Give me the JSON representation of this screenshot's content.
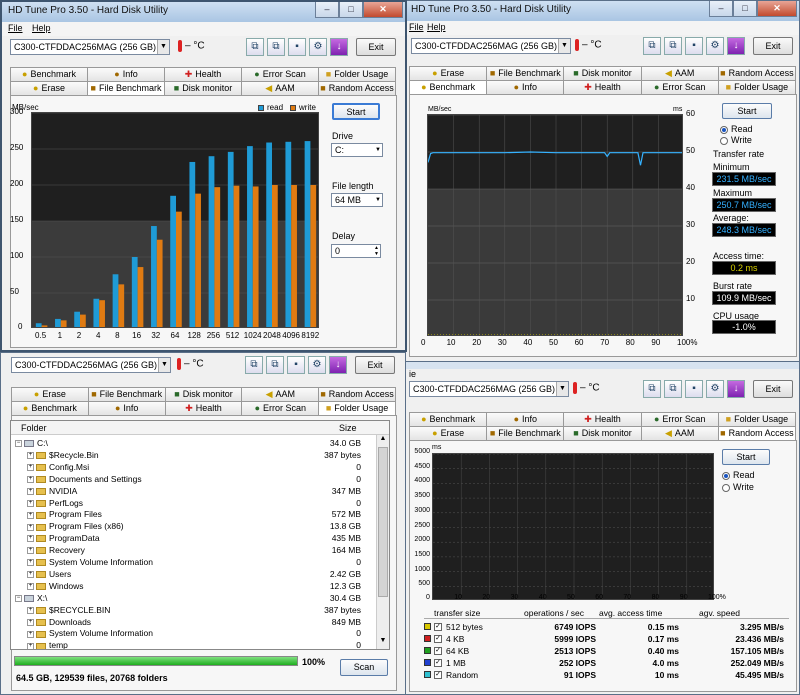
{
  "app_title": "HD Tune Pro 3.50 - Hard Disk Utility",
  "title_fragment": "ile",
  "drive_label": "C300-CTFDDAC256MAG (256 GB)",
  "temperature": "– °C",
  "exit_label": "Exit",
  "menu": {
    "file": "File",
    "help": "Help",
    "fragment": "ie"
  },
  "tabs": {
    "benchmark": "Benchmark",
    "info": "Info",
    "health": "Health",
    "error_scan": "Error Scan",
    "folder_usage": "Folder Usage",
    "erase": "Erase",
    "file_benchmark": "File Benchmark",
    "disk_monitor": "Disk monitor",
    "aam": "AAM",
    "random_access": "Random Access"
  },
  "colors": {
    "read": "#1f9bd6",
    "write": "#e07b12",
    "trace": "#35b2ff",
    "access": "#d8d000"
  },
  "file_benchmark": {
    "unit": "MB/sec",
    "start_label": "Start",
    "drive_label": "Drive",
    "drive_value": "C:",
    "file_length_label": "File length",
    "file_length_value": "64 MB",
    "delay_label": "Delay",
    "delay_value": "0",
    "legend_read": "read",
    "legend_write": "write"
  },
  "benchmark": {
    "unit_left": "MB/sec",
    "unit_right": "ms",
    "start_label": "Start",
    "read_label": "Read",
    "write_label": "Write",
    "transfer_rate_label": "Transfer rate",
    "minimum_label": "Minimum",
    "minimum_value": "231.5 MB/sec",
    "maximum_label": "Maximum",
    "maximum_value": "250.7 MB/sec",
    "average_label": "Average:",
    "average_value": "248.3 MB/sec",
    "access_label": "Access time:",
    "access_value": "0.2 ms",
    "burst_label": "Burst rate",
    "burst_value": "109.9 MB/sec",
    "cpu_label": "CPU usage",
    "cpu_value": "-1.0%"
  },
  "folder_usage": {
    "col_folder": "Folder",
    "col_size": "Size",
    "rows": [
      {
        "name": "C:\\",
        "size": "34.0 GB",
        "level": 0,
        "drive": true
      },
      {
        "name": "$Recycle.Bin",
        "size": "387 bytes",
        "level": 1
      },
      {
        "name": "Config.Msi",
        "size": "0",
        "level": 1
      },
      {
        "name": "Documents and Settings",
        "size": "0",
        "level": 1
      },
      {
        "name": "NVIDIA",
        "size": "347 MB",
        "level": 1
      },
      {
        "name": "PerfLogs",
        "size": "0",
        "level": 1
      },
      {
        "name": "Program Files",
        "size": "572 MB",
        "level": 1
      },
      {
        "name": "Program Files (x86)",
        "size": "13.8 GB",
        "level": 1
      },
      {
        "name": "ProgramData",
        "size": "435 MB",
        "level": 1
      },
      {
        "name": "Recovery",
        "size": "164 MB",
        "level": 1
      },
      {
        "name": "System Volume Information",
        "size": "0",
        "level": 1
      },
      {
        "name": "Users",
        "size": "2.42 GB",
        "level": 1
      },
      {
        "name": "Windows",
        "size": "12.3 GB",
        "level": 1
      },
      {
        "name": "X:\\",
        "size": "30.4 GB",
        "level": 0,
        "drive": true
      },
      {
        "name": "$RECYCLE.BIN",
        "size": "387 bytes",
        "level": 1
      },
      {
        "name": "Downloads",
        "size": "849 MB",
        "level": 1
      },
      {
        "name": "System Volume Information",
        "size": "0",
        "level": 1
      },
      {
        "name": "temp",
        "size": "0",
        "level": 1
      }
    ],
    "progress": 100,
    "progress_text": "100%",
    "summary": "64.5 GB, 129539 files, 20768 folders",
    "scan_label": "Scan"
  },
  "random_access": {
    "unit": "ms",
    "start_label": "Start",
    "read_label": "Read",
    "write_label": "Write",
    "headers": [
      "transfer size",
      "operations / sec",
      "avg. access time",
      "agv. speed"
    ],
    "rows": [
      {
        "size": "512 bytes",
        "ops": "6749 IOPS",
        "access": "0.15 ms",
        "speed": "3.295 MB/s",
        "color": "#d8c800"
      },
      {
        "size": "4 KB",
        "ops": "5999 IOPS",
        "access": "0.17 ms",
        "speed": "23.436 MB/s",
        "color": "#d02020"
      },
      {
        "size": "64 KB",
        "ops": "2513 IOPS",
        "access": "0.40 ms",
        "speed": "157.105 MB/s",
        "color": "#20a020"
      },
      {
        "size": "1 MB",
        "ops": "252 IOPS",
        "access": "4.0 ms",
        "speed": "252.049 MB/s",
        "color": "#2040d0"
      },
      {
        "size": "Random",
        "ops": "91 IOPS",
        "access": "10 ms",
        "speed": "45.495 MB/s",
        "color": "#30c0d0"
      }
    ]
  },
  "chart_data": [
    {
      "type": "bar",
      "title": "",
      "ylabel": "MB/sec",
      "ylim": [
        0,
        300
      ],
      "yticks": [
        50,
        100,
        150,
        200,
        250,
        300
      ],
      "categories": [
        "0.5",
        "1",
        "2",
        "4",
        "8",
        "16",
        "32",
        "64",
        "128",
        "256",
        "512",
        "1024",
        "2048",
        "4096",
        "8192"
      ],
      "series": [
        {
          "name": "read",
          "values": [
            8,
            14,
            24,
            42,
            76,
            100,
            143,
            185,
            232,
            240,
            246,
            254,
            259,
            260,
            261
          ]
        },
        {
          "name": "write",
          "values": [
            5,
            12,
            20,
            40,
            62,
            86,
            124,
            163,
            188,
            197,
            199,
            198,
            200,
            200,
            200
          ]
        }
      ],
      "legend": "top-right"
    },
    {
      "type": "line",
      "ylabel": "MB/sec",
      "y2label": "ms",
      "ylim": [
        0,
        300
      ],
      "y2lim": [
        0,
        60
      ],
      "yticks": [
        50,
        100,
        150,
        200,
        250,
        300
      ],
      "y2ticks": [
        10,
        20,
        30,
        40,
        50,
        60
      ],
      "xticks": [
        "0",
        "10",
        "20",
        "30",
        "40",
        "50",
        "60",
        "70",
        "80",
        "90",
        "100%"
      ],
      "series": [
        {
          "name": "transfer rate",
          "x": [
            0,
            1,
            2,
            3,
            10,
            20,
            30,
            40,
            50,
            60,
            69,
            70,
            71,
            80,
            82,
            83,
            84,
            90,
            100
          ],
          "values": [
            236,
            248,
            249,
            249,
            249,
            249,
            249,
            250,
            249,
            249,
            249,
            244,
            249,
            249,
            249,
            232,
            249,
            249,
            249
          ]
        }
      ]
    },
    {
      "type": "scatter",
      "ylabel": "ms",
      "ylim": [
        0,
        5000
      ],
      "yticks": [
        500,
        1000,
        1500,
        2000,
        2500,
        3000,
        3500,
        4000,
        4500,
        5000
      ],
      "xticks": [
        "0",
        "10",
        "20",
        "30",
        "40",
        "50",
        "60",
        "70",
        "80",
        "90",
        "100%"
      ]
    }
  ]
}
